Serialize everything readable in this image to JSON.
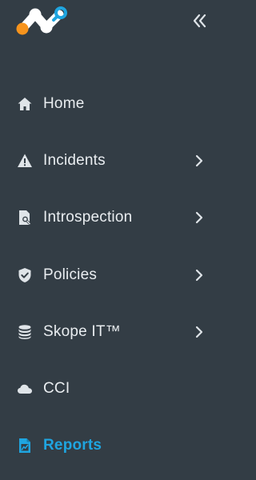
{
  "colors": {
    "background": "#333d45",
    "text": "#e9edf0",
    "icon": "#dfe4e8",
    "active": "#1fa5e0",
    "logo_orange": "#f7941d",
    "logo_blue": "#1fa5e0",
    "logo_white": "#ffffff"
  },
  "header": {
    "logo_icon": "netskope-logo-icon",
    "collapse_icon": "double-chevron-left-icon"
  },
  "nav": {
    "items": [
      {
        "label": "Home",
        "icon": "home-icon",
        "has_submenu": false,
        "active": false
      },
      {
        "label": "Incidents",
        "icon": "warning-icon",
        "has_submenu": true,
        "active": false
      },
      {
        "label": "Introspection",
        "icon": "document-search-icon",
        "has_submenu": true,
        "active": false
      },
      {
        "label": "Policies",
        "icon": "shield-check-icon",
        "has_submenu": true,
        "active": false
      },
      {
        "label": "Skope IT™",
        "icon": "database-icon",
        "has_submenu": true,
        "active": false
      },
      {
        "label": "CCI",
        "icon": "cloud-icon",
        "has_submenu": false,
        "active": false
      },
      {
        "label": "Reports",
        "icon": "report-chart-icon",
        "has_submenu": false,
        "active": true
      }
    ]
  }
}
